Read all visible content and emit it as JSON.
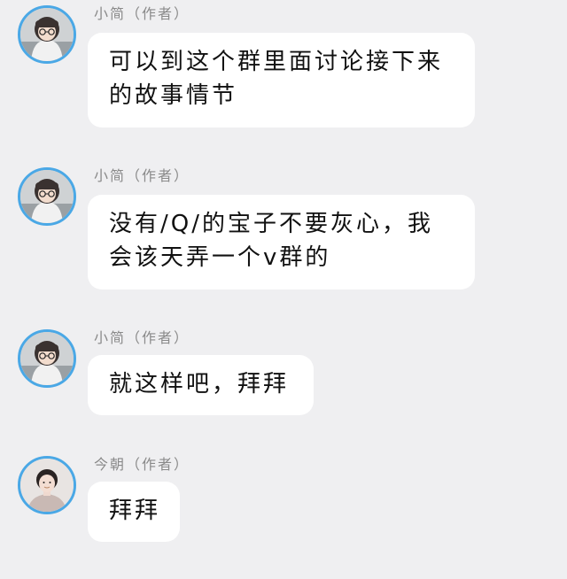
{
  "messages": [
    {
      "sender": "小简（作者）",
      "avatar_icon": "girl-with-glasses-avatar",
      "text": "可以到这个群里面讨论接下来的故事情节"
    },
    {
      "sender": "小简（作者）",
      "avatar_icon": "girl-with-glasses-avatar",
      "text": "没有/Q/的宝子不要灰心，我会该天弄一个v群的"
    },
    {
      "sender": "小简（作者）",
      "avatar_icon": "girl-with-glasses-avatar",
      "text": "就这样吧，拜拜"
    },
    {
      "sender": "今朝（作者）",
      "avatar_icon": "boy-portrait-avatar",
      "text": "拜拜"
    }
  ],
  "colors": {
    "background": "#efeff1",
    "bubble": "#ffffff",
    "avatar_ring": "#4aa8e6",
    "sender_text": "#8a8a8a"
  }
}
